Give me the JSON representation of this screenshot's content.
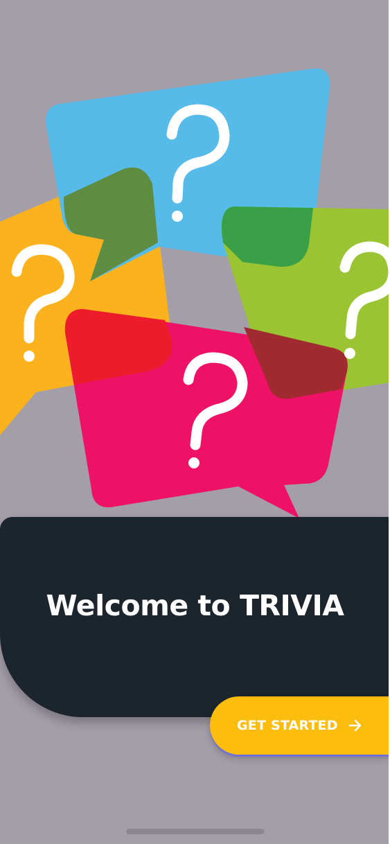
{
  "colors": {
    "background": "#a49ea9",
    "card": "#1c252c",
    "accent": "#fcbd0c",
    "blue_bubble": "#56bbe9",
    "orange_bubble": "#fbb21c",
    "green_bubble": "#9bc432",
    "pink_bubble": "#ee1165"
  },
  "hero": {
    "illustration": "question-mark-speech-bubbles"
  },
  "welcome": {
    "title": "Welcome to TRIVIA"
  },
  "cta": {
    "label": "GET STARTED",
    "icon": "arrow-right-icon"
  }
}
